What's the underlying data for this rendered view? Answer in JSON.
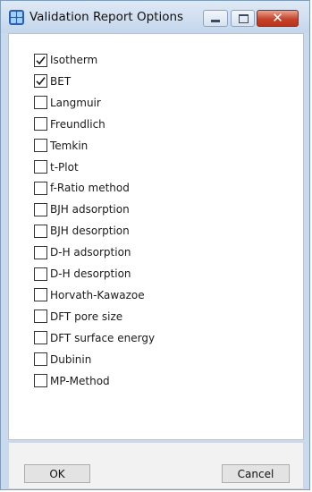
{
  "window": {
    "title": "Validation Report Options"
  },
  "options": [
    {
      "label": "Isotherm",
      "checked": true
    },
    {
      "label": "BET",
      "checked": true
    },
    {
      "label": "Langmuir",
      "checked": false
    },
    {
      "label": "Freundlich",
      "checked": false
    },
    {
      "label": "Temkin",
      "checked": false
    },
    {
      "label": "t-Plot",
      "checked": false
    },
    {
      "label": "f-Ratio method",
      "checked": false
    },
    {
      "label": "BJH adsorption",
      "checked": false
    },
    {
      "label": "BJH desorption",
      "checked": false
    },
    {
      "label": "D-H adsorption",
      "checked": false
    },
    {
      "label": "D-H desorption",
      "checked": false
    },
    {
      "label": "Horvath-Kawazoe",
      "checked": false
    },
    {
      "label": "DFT pore size",
      "checked": false
    },
    {
      "label": "DFT surface energy",
      "checked": false
    },
    {
      "label": "Dubinin",
      "checked": false
    },
    {
      "label": "MP-Method",
      "checked": false
    }
  ],
  "buttons": {
    "ok": "OK",
    "cancel": "Cancel"
  },
  "colors": {
    "window_frame": "#c9daee",
    "close_button": "#c6432a",
    "checkmark": "#1a1a1a"
  },
  "icons": {
    "app": "grid-app-icon",
    "minimize": "minimize-icon",
    "maximize": "maximize-icon",
    "close": "close-icon",
    "check": "checkmark-icon"
  }
}
